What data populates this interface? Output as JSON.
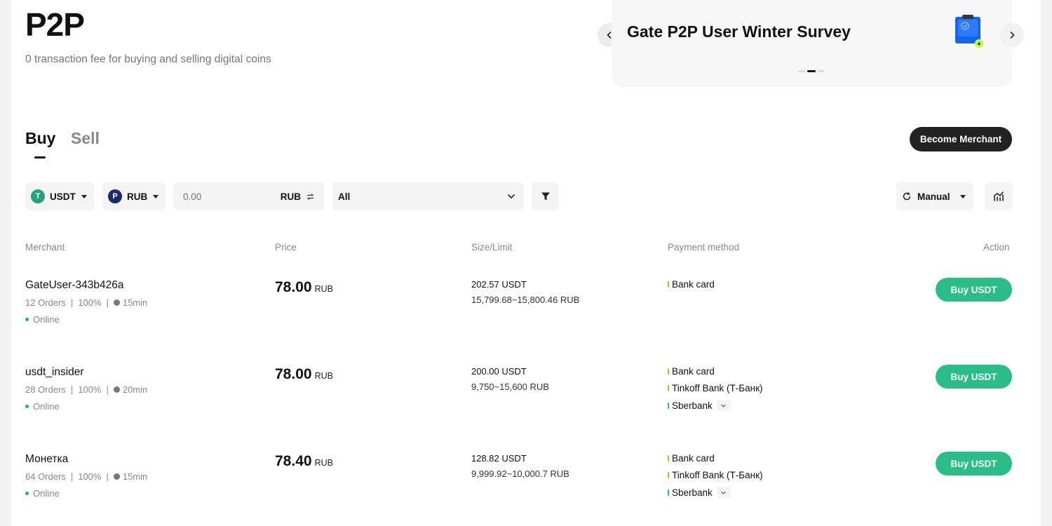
{
  "header": {
    "title": "P2P",
    "subtitle": "0 transaction fee for buying and selling digital coins"
  },
  "banner": {
    "title": "Gate P2P User Winter Survey",
    "slide_count": 2,
    "active_slide": 1
  },
  "tabs": {
    "buy": "Buy",
    "sell": "Sell",
    "active": "Buy"
  },
  "become_merchant": "Become Merchant",
  "filters": {
    "coin": "USDT",
    "coin_icon_letter": "T",
    "fiat": "RUB",
    "fiat_icon_letter": "P",
    "amount_placeholder": "0.00",
    "amount_currency": "RUB",
    "payment_method": "All",
    "refresh_mode": "Manual"
  },
  "table": {
    "headers": {
      "merchant": "Merchant",
      "price": "Price",
      "size_limit": "Size/Limit",
      "payment_method": "Payment method",
      "action": "Action"
    },
    "rows": [
      {
        "merchant": "GateUser-343b426a",
        "orders": "12 Orders",
        "completion": "100%",
        "time": "15min",
        "status": "Online",
        "price": "78.00",
        "currency": "RUB",
        "size": "202.57 USDT",
        "limit": "15,799.68~15,800.46 RUB",
        "payments": [
          {
            "name": "Bank card",
            "color": "#f0a020"
          }
        ],
        "action": "Buy USDT"
      },
      {
        "merchant": "usdt_insider",
        "orders": "28 Orders",
        "completion": "100%",
        "time": "20min",
        "status": "Online",
        "price": "78.00",
        "currency": "RUB",
        "size": "200.00 USDT",
        "limit": "9,750~15,600 RUB",
        "payments": [
          {
            "name": "Bank card",
            "color": "#f0a020"
          },
          {
            "name": "Tinkoff Bank (Т-Банк)",
            "color": "#f0a020"
          },
          {
            "name": "Sberbank",
            "color": "#2bbd86"
          }
        ],
        "action": "Buy USDT"
      },
      {
        "merchant": "Монетка",
        "orders": "64 Orders",
        "completion": "100%",
        "time": "15min",
        "status": "Online",
        "price": "78.40",
        "currency": "RUB",
        "size": "128.82 USDT",
        "limit": "9,999.92~10,000.7 RUB",
        "payments": [
          {
            "name": "Bank card",
            "color": "#f0a020"
          },
          {
            "name": "Tinkoff Bank (Т-Банк)",
            "color": "#f0a020"
          },
          {
            "name": "Sberbank",
            "color": "#2bbd86"
          }
        ],
        "action": "Buy USDT"
      }
    ]
  },
  "colors": {
    "accent_green": "#2bbd86",
    "tether_green": "#26a17b",
    "ruble_blue": "#1a2a6c",
    "dark_button": "#222222"
  }
}
